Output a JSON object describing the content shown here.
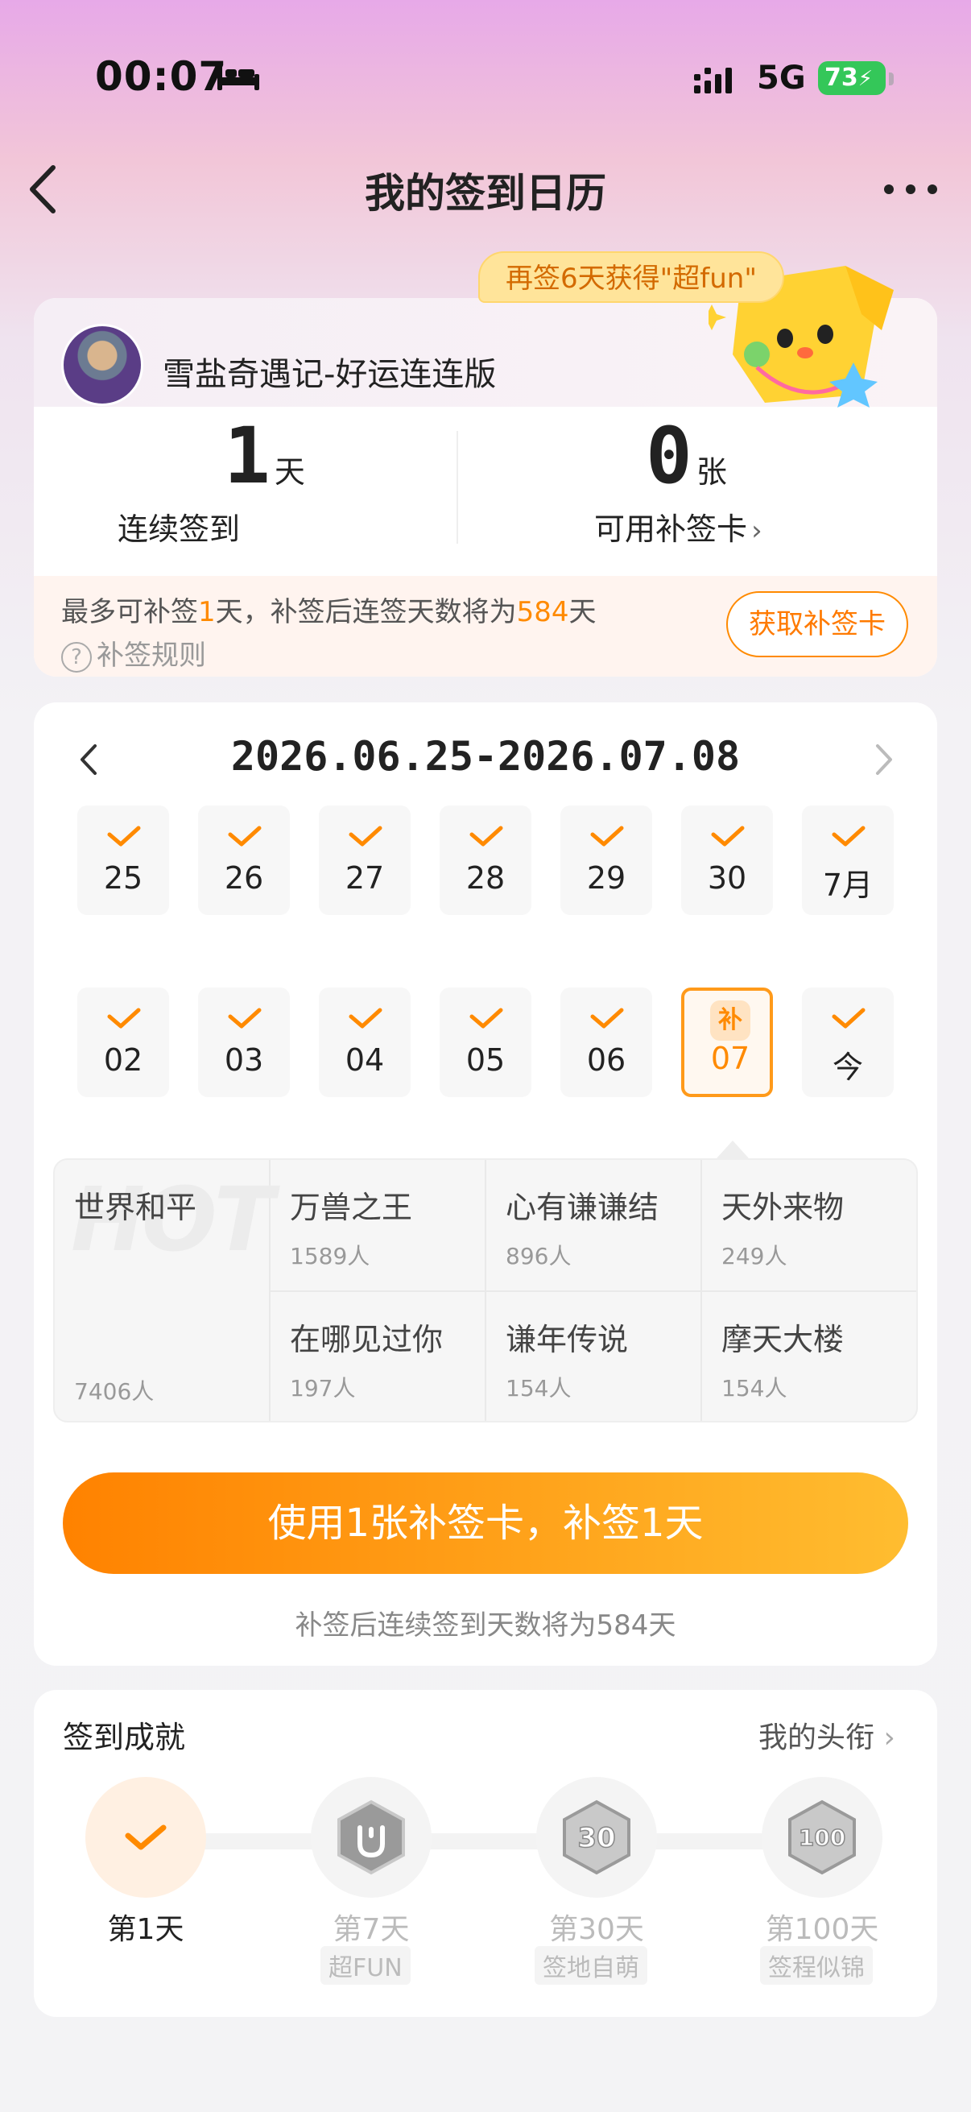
{
  "status_bar": {
    "time": "00:07",
    "network": "5G",
    "battery": "73"
  },
  "nav": {
    "title": "我的签到日历"
  },
  "tooltip": {
    "text": "再签6天获得\"超fun\""
  },
  "user": {
    "name": "雪盐奇遇记-好运连连版"
  },
  "stats": {
    "streak": {
      "value": "1",
      "unit": "天",
      "label": "连续签到"
    },
    "cards": {
      "value": "0",
      "unit": "张",
      "label": "可用补签卡"
    }
  },
  "makeup": {
    "text_prefix": "最多可补签",
    "days": "1",
    "text_middle": "天，补签后连签天数将为",
    "total": "584",
    "text_suffix": "天",
    "rules": "补签规则",
    "get_button": "获取补签卡"
  },
  "calendar": {
    "range": "2026.06.25-2026.07.08",
    "row1": [
      "25",
      "26",
      "27",
      "28",
      "29",
      "30",
      "7月"
    ],
    "row2": [
      "02",
      "03",
      "04",
      "05",
      "06",
      "07",
      "今"
    ],
    "makeup_badge": "补",
    "selected_day": "07"
  },
  "titles": {
    "watermark": "HOT",
    "featured": {
      "name": "世界和平",
      "count": "7406人"
    },
    "items": [
      {
        "name": "万兽之王",
        "count": "1589人"
      },
      {
        "name": "心有谦谦结",
        "count": "896人"
      },
      {
        "name": "天外来物",
        "count": "249人"
      },
      {
        "name": "在哪见过你",
        "count": "197人"
      },
      {
        "name": "谦年传说",
        "count": "154人"
      },
      {
        "name": "摩天大楼",
        "count": "154人"
      }
    ]
  },
  "action": {
    "button": "使用1张补签卡，补签1天",
    "note": "补签后连续签到天数将为584天"
  },
  "achievements": {
    "title": "签到成就",
    "link": "我的头衔",
    "items": [
      {
        "day": "第1天",
        "tag": "",
        "achieved": true
      },
      {
        "day": "第7天",
        "tag": "超FUN",
        "achieved": false
      },
      {
        "day": "第30天",
        "tag": "签地自萌",
        "achieved": false
      },
      {
        "day": "第100天",
        "tag": "签程似锦",
        "achieved": false
      }
    ]
  },
  "colors": {
    "accent": "#ff8a00",
    "battery": "#34c759"
  }
}
